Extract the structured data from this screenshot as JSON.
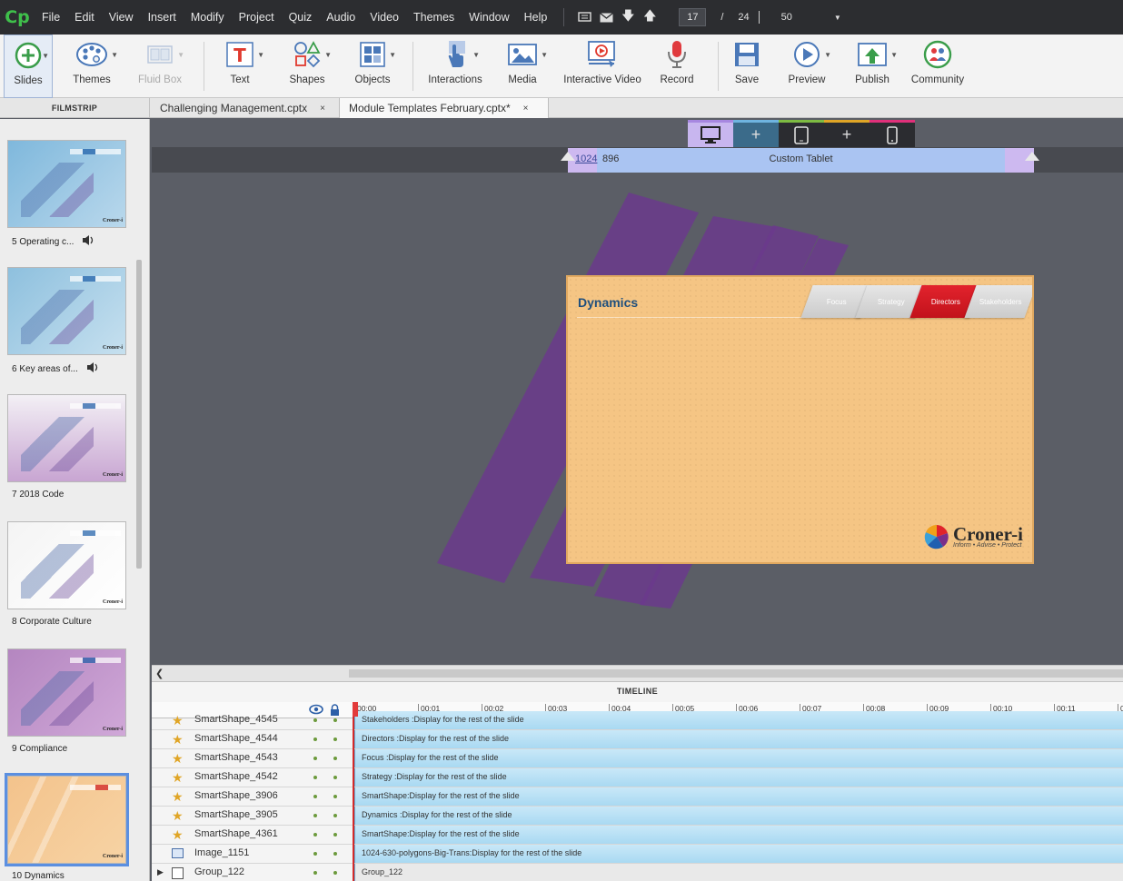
{
  "app": {
    "logo": "Cp"
  },
  "menu": [
    "File",
    "Edit",
    "View",
    "Insert",
    "Modify",
    "Project",
    "Quiz",
    "Audio",
    "Video",
    "Themes",
    "Window",
    "Help"
  ],
  "nav": {
    "current_slide": "17",
    "separator": "/",
    "total_slides": "24",
    "zoom": "50"
  },
  "toolbar": {
    "slides": "Slides",
    "themes": "Themes",
    "fluid_box": "Fluid Box",
    "text": "Text",
    "shapes": "Shapes",
    "objects": "Objects",
    "interactions": "Interactions",
    "media": "Media",
    "interactive_video": "Interactive Video",
    "record": "Record",
    "save": "Save",
    "preview": "Preview",
    "publish": "Publish",
    "community": "Community"
  },
  "tabs": {
    "filmstrip": "FILMSTRIP",
    "doc1": "Challenging Management.cptx",
    "doc2": "Module Templates February.cptx*",
    "close": "×"
  },
  "filmstrip": [
    {
      "label": "5 Operating c...",
      "audio": true,
      "theme": "blue"
    },
    {
      "label": "6 Key areas of...",
      "audio": true,
      "theme": "blue2"
    },
    {
      "label": "7 2018 Code",
      "audio": false,
      "theme": "purplewhite"
    },
    {
      "label": "8 Corporate Culture",
      "audio": false,
      "theme": "white"
    },
    {
      "label": "9 Compliance",
      "audio": false,
      "theme": "purple"
    },
    {
      "label": "10 Dynamics",
      "audio": false,
      "theme": "orange"
    }
  ],
  "thumb_logo": "Croner-i",
  "breakpoint": {
    "width_a": "1024",
    "width_b": "896",
    "name": "Custom Tablet"
  },
  "slide": {
    "title": "Dynamics",
    "tabs": [
      "Focus",
      "Strategy",
      "Directors",
      "Stakeholders"
    ],
    "active_tab": "Directors",
    "logo": "Croner-i",
    "tagline": "Inform • Advise • Protect"
  },
  "timeline": {
    "title": "TIMELINE",
    "ticks": [
      "00:00",
      "00:01",
      "00:02",
      "00:03",
      "00:04",
      "00:05",
      "00:06",
      "00:07",
      "00:08",
      "00:09",
      "00:10",
      "00:11",
      "0"
    ],
    "rows": [
      {
        "name": "SmartShape_4545",
        "icon": "star",
        "bar": "Stakeholders :Display for the rest of the slide"
      },
      {
        "name": "SmartShape_4544",
        "icon": "star",
        "bar": "Directors :Display for the rest of the slide"
      },
      {
        "name": "SmartShape_4543",
        "icon": "star",
        "bar": "Focus :Display for the rest of the slide"
      },
      {
        "name": "SmartShape_4542",
        "icon": "star",
        "bar": "Strategy :Display for the rest of the slide"
      },
      {
        "name": "SmartShape_3906",
        "icon": "star",
        "bar": "SmartShape:Display for the rest of the slide"
      },
      {
        "name": "SmartShape_3905",
        "icon": "star",
        "bar": "Dynamics :Display for the rest of the slide"
      },
      {
        "name": "SmartShape_4361",
        "icon": "star",
        "bar": "SmartShape:Display for the rest of the slide"
      },
      {
        "name": "Image_1151",
        "icon": "image",
        "bar": "1024-630-polygons-Big-Trans:Display for the rest of the slide"
      },
      {
        "name": "Group_122",
        "icon": "group",
        "bar": "Group_122"
      }
    ]
  },
  "colors": {
    "accent_green": "#3fbf4b",
    "slide_bg": "#f5c584",
    "active_tab_red": "#d0181f",
    "polygon_purple": "#6b3a8c"
  }
}
